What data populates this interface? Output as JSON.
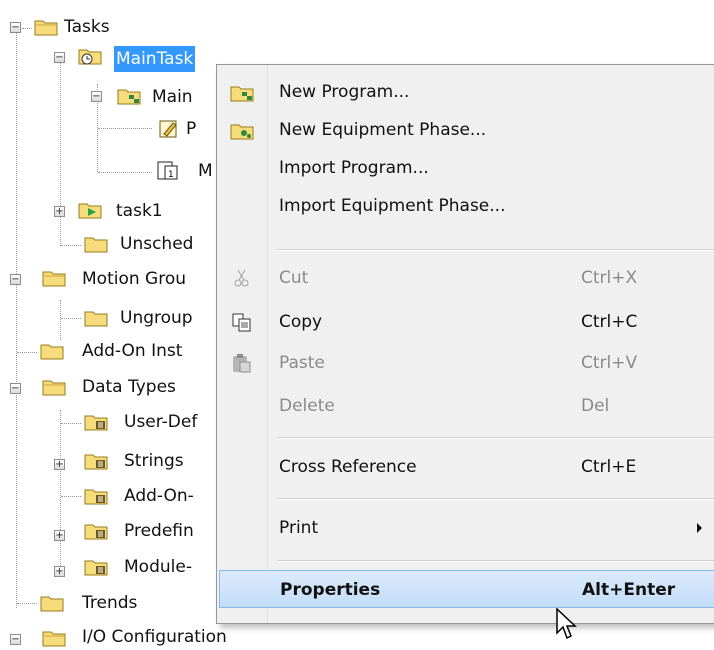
{
  "tree": {
    "tasks": "Tasks",
    "main_task": "MainTask",
    "main_program": "Main",
    "parameters": "P",
    "main_routine": "M",
    "task1": "task1",
    "unscheduled": "Unsched",
    "motion_groups": "Motion Grou",
    "ungrouped": "Ungroup",
    "addon_instructions": "Add-On Inst",
    "data_types": "Data Types",
    "user_defined": "User-Def",
    "strings": "Strings",
    "addon_defined": "Add-On-",
    "predefined": "Predefin",
    "module_defined": "Module-",
    "trends": "Trends",
    "io_configuration": "I/O Configuration"
  },
  "menu": {
    "new_program": "New Program...",
    "new_equipment_phase": "New Equipment Phase...",
    "import_program": "Import Program...",
    "import_equipment_phase": "Import Equipment Phase...",
    "cut": "Cut",
    "cut_key": "Ctrl+X",
    "copy": "Copy",
    "copy_key": "Ctrl+C",
    "paste": "Paste",
    "paste_key": "Ctrl+V",
    "delete": "Delete",
    "delete_key": "Del",
    "cross_reference": "Cross Reference",
    "cross_reference_key": "Ctrl+E",
    "print": "Print",
    "properties": "Properties",
    "properties_key": "Alt+Enter"
  },
  "colors": {
    "selection": "#3399ff",
    "folder": "#f3d35e",
    "menu_highlight": "#c2dcf8"
  },
  "icons": [
    "folder-icon",
    "task-icon",
    "program-icon",
    "routine-icon",
    "datatype-icon",
    "scissors-icon",
    "copy-icon",
    "paste-icon",
    "mouse-cursor-icon"
  ]
}
